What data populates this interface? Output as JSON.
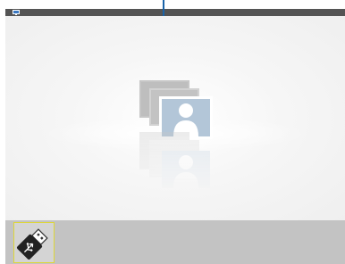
{
  "title_bar": {
    "icon": "monitor-icon"
  },
  "main": {
    "placeholder_icon": "photo-gallery-person-icon"
  },
  "bottom_bar": {
    "items": [
      {
        "icon": "usb-drive-icon",
        "selected": true
      }
    ]
  },
  "colors": {
    "title_bar": "#545454",
    "pointer": "#1a63a8",
    "bottom_bar": "#c3c3c3",
    "selection_border": "#ddd63a",
    "photo_front": "#b5c7d8",
    "photo_back": "#bdbdbd"
  }
}
